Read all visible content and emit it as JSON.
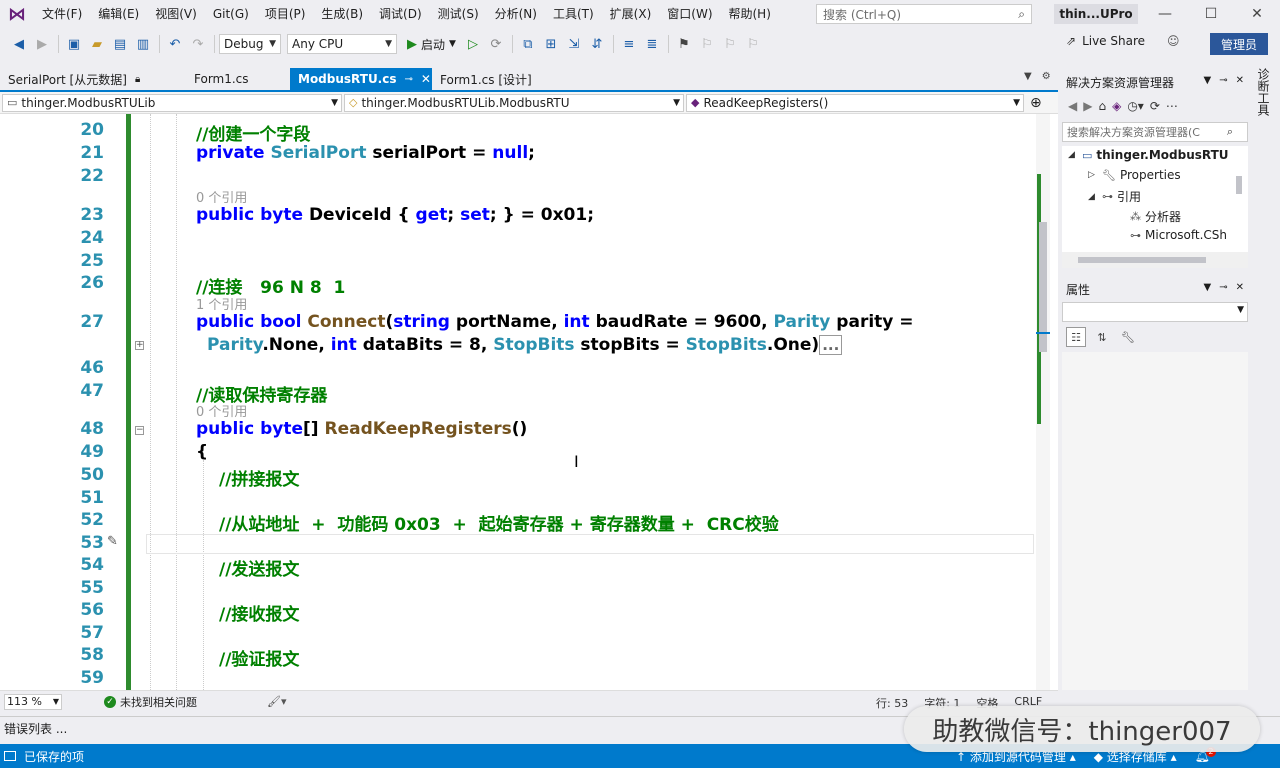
{
  "menu": [
    "文件(F)",
    "编辑(E)",
    "视图(V)",
    "Git(G)",
    "项目(P)",
    "生成(B)",
    "调试(D)",
    "测试(S)",
    "分析(N)",
    "工具(T)",
    "扩展(X)",
    "窗口(W)",
    "帮助(H)"
  ],
  "search": {
    "placeholder": "搜索 (Ctrl+Q)"
  },
  "project_title": "thin...UPro",
  "toolbar": {
    "config": "Debug",
    "platform": "Any CPU",
    "start_label": "启动",
    "live_share": "Live Share",
    "admin": "管理员"
  },
  "doc_tabs": [
    {
      "label": "SerialPort [从元数据]"
    },
    {
      "label": "Form1.cs"
    },
    {
      "label": "ModbusRTU.cs",
      "active": true
    },
    {
      "label": "Form1.cs [设计]"
    }
  ],
  "nav": {
    "project": "thinger.ModbusRTULib",
    "class": "thinger.ModbusRTULib.ModbusRTU",
    "member": "ReadKeepRegisters()"
  },
  "editor": {
    "line_numbers": [
      "20",
      "21",
      "22",
      "23",
      "24",
      "25",
      "26",
      "27",
      "46",
      "47",
      "48",
      "49",
      "50",
      "51",
      "52",
      "53",
      "54",
      "55",
      "56",
      "57",
      "58",
      "59"
    ],
    "codelens": [
      "0 个引用",
      "1 个引用",
      "0 个引用"
    ],
    "lines": {
      "l20": "//创建一个字段",
      "l21_kw": "private",
      "l21_ty": "SerialPort",
      "l21_name": "serialPort",
      "l21_eq": " = ",
      "l21_null": "null",
      "l21_end": ";",
      "l23_kw1": "public",
      "l23_kw2": "byte",
      "l23_name": "DeviceId { ",
      "l23_get": "get",
      "l23_mid": "; ",
      "l23_set": "set",
      "l23_end": "; } = 0x01;",
      "l26": "//连接   96 N 8  1",
      "l27_kw1": "public",
      "l27_kw2": "bool",
      "l27_m": "Connect",
      "l27_p1": "(",
      "l27_kw3": "string",
      "l27_p2": " portName, ",
      "l27_kw4": "int",
      "l27_p3": " baudRate = 9600, ",
      "l27_ty1": "Parity",
      "l27_p4": " parity =",
      "l27b_ty": "Parity",
      "l27b_p1": ".None, ",
      "l27b_kw": "int",
      "l27b_p2": " dataBits = 8, ",
      "l27b_ty2": "StopBits",
      "l27b_p3": " stopBits = ",
      "l27b_ty3": "StopBits",
      "l27b_p4": ".One)",
      "l27b_coll": "...",
      "l47": "//读取保持寄存器",
      "l48_kw1": "public",
      "l48_kw2": "byte",
      "l48_br": "[] ",
      "l48_m": "ReadKeepRegisters",
      "l48_end": "()",
      "l49": "{",
      "l50": "//拼接报文",
      "l52": "//从站地址  +  功能码 0x03  +  起始寄存器 + 寄存器数量 +  CRC校验",
      "l54": "//发送报文",
      "l56": "//接收报文",
      "l58": "//验证报文"
    }
  },
  "editor_status": {
    "zoom": "113 %",
    "issues": "未找到相关问题",
    "line": "行: 53",
    "char": "字符: 1",
    "space": "空格",
    "eol": "CRLF"
  },
  "solution_explorer": {
    "title": "解决方案资源管理器",
    "search_placeholder": "搜索解决方案资源管理器(C",
    "tree": [
      "thinger.ModbusRTU",
      "Properties",
      "引用",
      "分析器",
      "Microsoft.CSh"
    ]
  },
  "properties": {
    "title": "属性"
  },
  "side_tab": "诊断工具",
  "error_list": "错误列表 ...",
  "statusbar": {
    "saved": "已保存的项",
    "add_source": "添加到源代码管理",
    "select_repo": "选择存储库",
    "notif_count": "2"
  },
  "watermark": "助教微信号：thinger007",
  "colors": {
    "accent": "#007acc",
    "keyword": "#0000ff",
    "type": "#2b91af",
    "comment": "#008000",
    "method": "#74531f",
    "change_bar": "#2e8b2e"
  }
}
